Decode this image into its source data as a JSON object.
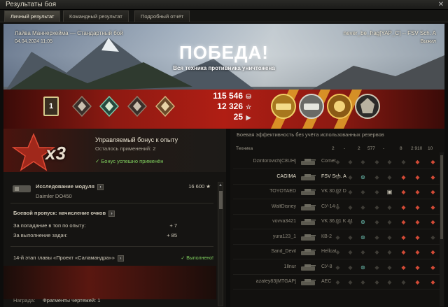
{
  "window": {
    "title": "Результаты боя",
    "close": "✕"
  },
  "tabs": [
    {
      "label": "Личный результат",
      "active": true
    },
    {
      "label": "Командный результат",
      "active": false
    },
    {
      "label": "Подробный отчёт",
      "active": false
    }
  ],
  "banner": {
    "map": "Лайва Маннерхейма — Стандартный бой",
    "date": "04.04.2024 11:05",
    "player": "never_be_frag[YAP_C] -- FSV Sch. A",
    "status": "Выжил",
    "result": "ПОБЕДА!",
    "result_sub": "Вся техника противника уничтожена",
    "place": "1",
    "credits": "115 546",
    "xp": "12 326",
    "free_xp": "25",
    "colors": {
      "accent_red": "#b01e14",
      "gold": "#e4a52a",
      "green": "#7fcf5e"
    }
  },
  "bonus": {
    "multiplier": "x3",
    "title": "Управляемый бонус к опыту",
    "remaining": "Осталось применений: 2",
    "applied": "✓ Бонус успешно применён"
  },
  "details": {
    "module_title": "Исследование модуля",
    "module_name": "Daimler DO450",
    "module_value": "16 600 ★",
    "bp_title": "Боевой пропуск: начисление очков",
    "bp_rows": [
      {
        "label": "За попадание в топ по опыту:",
        "value": "+ 7"
      },
      {
        "label": "За выполнение задач:",
        "value": "+ 85"
      }
    ],
    "stage_title": "14-й этап главы «Проект «Саламандра»»",
    "stage_done": "✓ Выполнено!",
    "reward_label": "Награда:",
    "reward_value": "Фрагменты чертежей: 1"
  },
  "team": {
    "header": "Боевая эффективность без учёта использованных резервов",
    "col_tank": "Техника",
    "columns": [
      "2",
      "-",
      "2",
      "577",
      "-",
      "8",
      "2 910",
      "10"
    ],
    "rows": [
      {
        "nick": "Dzintorovich[C8UH]",
        "tank": "Comet",
        "me": false,
        "cells": [
          "",
          "",
          "",
          "",
          "",
          "",
          "r",
          "r"
        ]
      },
      {
        "nick": "CAGIMA",
        "tank": "FSV Sch. A",
        "me": true,
        "cells": [
          "",
          "",
          "g",
          "",
          "",
          "r",
          "r",
          "r"
        ]
      },
      {
        "nick": "TOYOTAED",
        "tank": "VK 30.02 D",
        "me": false,
        "cells": [
          "",
          "",
          "",
          "",
          "w",
          "r",
          "r",
          "r"
        ]
      },
      {
        "nick": "WaltDisney",
        "tank": "СУ-14-1",
        "me": false,
        "cells": [
          "",
          "",
          "",
          "",
          "",
          "r",
          "r",
          "r"
        ]
      },
      {
        "nick": "vovva3421",
        "tank": "VK 36.01 K 41",
        "me": false,
        "cells": [
          "",
          "",
          "g",
          "",
          "",
          "r",
          "r",
          "r"
        ]
      },
      {
        "nick": "yura123_1",
        "tank": "КВ-2",
        "me": false,
        "cells": [
          "",
          "",
          "g",
          "",
          "",
          "r",
          "r",
          ""
        ]
      },
      {
        "nick": "Sand_Devil",
        "tank": "Hellcat",
        "me": false,
        "cells": [
          "",
          "",
          "",
          "",
          "",
          "r",
          "r",
          "r"
        ]
      },
      {
        "nick": "1Ilnur",
        "tank": "СУ-8",
        "me": false,
        "cells": [
          "",
          "",
          "g",
          "",
          "",
          "r",
          "r",
          "r"
        ]
      },
      {
        "nick": "azatey83[MTGAP]",
        "tank": "AEC",
        "me": false,
        "cells": [
          "",
          "",
          "",
          "",
          "",
          "",
          "r",
          "r"
        ]
      }
    ]
  }
}
